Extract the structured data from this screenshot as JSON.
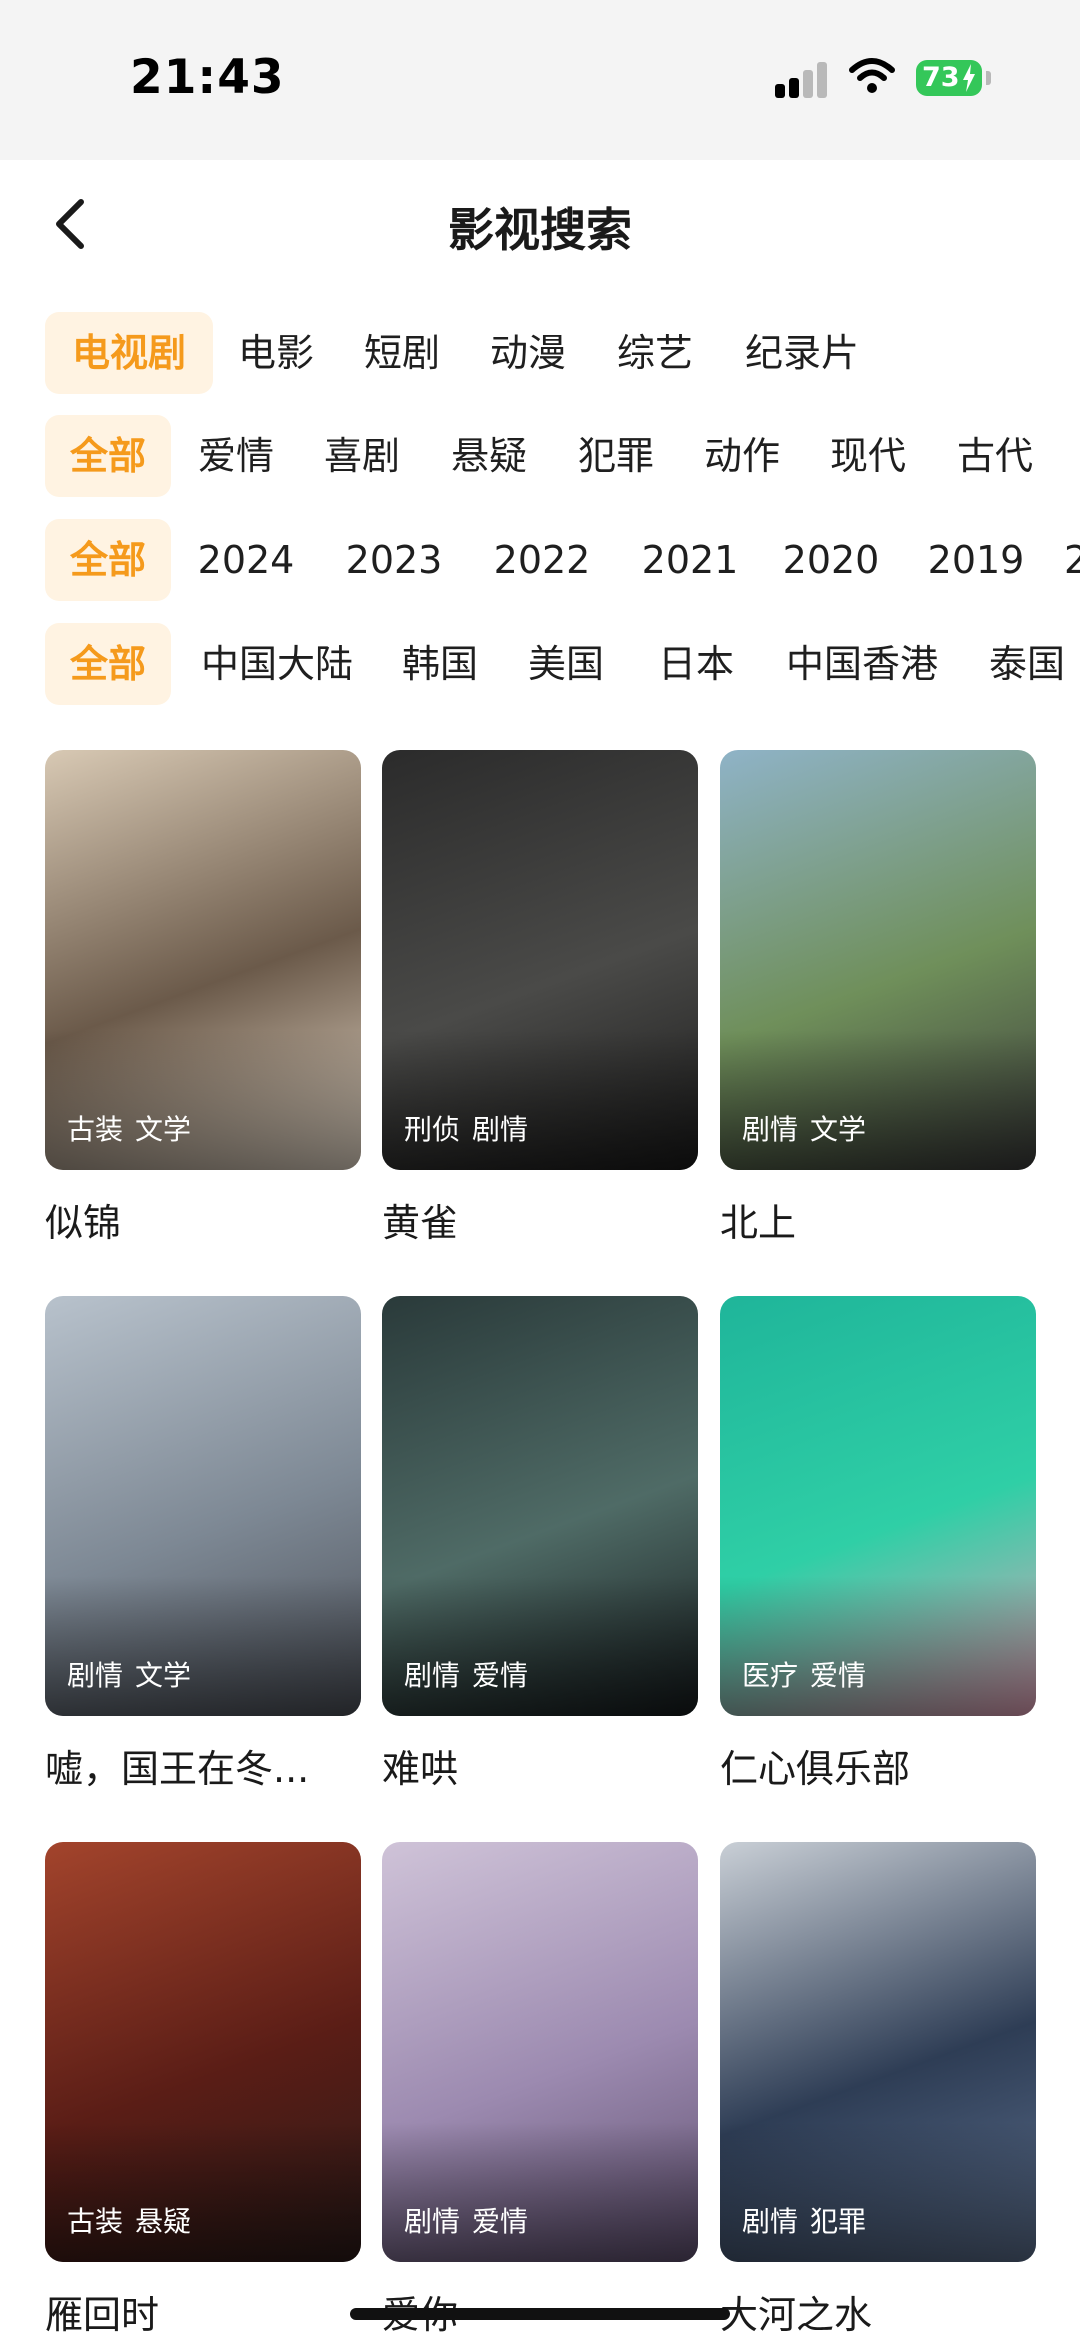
{
  "status_bar": {
    "time": "21:43",
    "battery": "73",
    "colors": {
      "battery": "#34c759"
    }
  },
  "header": {
    "title": "影视搜索",
    "back_icon": "chevron-left-icon"
  },
  "filters": {
    "active_color": "#f59a1c",
    "active_bg": "#fff3e2",
    "type": [
      "电视剧",
      "电影",
      "短剧",
      "动漫",
      "综艺",
      "纪录片"
    ],
    "genre": [
      "全部",
      "爱情",
      "喜剧",
      "悬疑",
      "犯罪",
      "动作",
      "现代",
      "古代"
    ],
    "year": [
      "全部",
      "2024",
      "2023",
      "2022",
      "2021",
      "2020",
      "2019",
      "2"
    ],
    "region": [
      "全部",
      "中国大陆",
      "韩国",
      "美国",
      "日本",
      "中国香港",
      "泰国"
    ]
  },
  "items": [
    {
      "title": "似锦",
      "tags": [
        "古装",
        "文学"
      ],
      "poster_colors": [
        "#d8c9b4",
        "#6b5a4a",
        "#e9dccb"
      ]
    },
    {
      "title": "黄雀",
      "tags": [
        "刑侦",
        "剧情"
      ],
      "poster_colors": [
        "#2b2b2b",
        "#4a4a48",
        "#1a1a1a"
      ]
    },
    {
      "title": "北上",
      "tags": [
        "剧情",
        "文学"
      ],
      "poster_colors": [
        "#8fb3c7",
        "#6f8f5a",
        "#3a3a3a"
      ]
    },
    {
      "title": "嘘，国王在冬...",
      "tags": [
        "剧情",
        "文学"
      ],
      "poster_colors": [
        "#b8c2cc",
        "#7d8894",
        "#4b4f57"
      ]
    },
    {
      "title": "难哄",
      "tags": [
        "剧情",
        "爱情"
      ],
      "poster_colors": [
        "#2a3a3a",
        "#4f6b66",
        "#151a1c"
      ]
    },
    {
      "title": "仁心俱乐部",
      "tags": [
        "医疗",
        "爱情"
      ],
      "poster_colors": [
        "#1fb59a",
        "#2fcfa6",
        "#e6a0b8"
      ]
    },
    {
      "title": "雁回时",
      "tags": [
        "古装",
        "悬疑"
      ],
      "poster_colors": [
        "#a3442c",
        "#5a1d16",
        "#2a1a18"
      ]
    },
    {
      "title": "爱你",
      "tags": [
        "剧情",
        "爱情"
      ],
      "poster_colors": [
        "#cfc3d8",
        "#9c8ab0",
        "#5e4f6e"
      ]
    },
    {
      "title": "大河之水",
      "tags": [
        "剧情",
        "犯罪"
      ],
      "poster_colors": [
        "#c9cfd6",
        "#2e3d55",
        "#5b6e8c"
      ]
    }
  ]
}
